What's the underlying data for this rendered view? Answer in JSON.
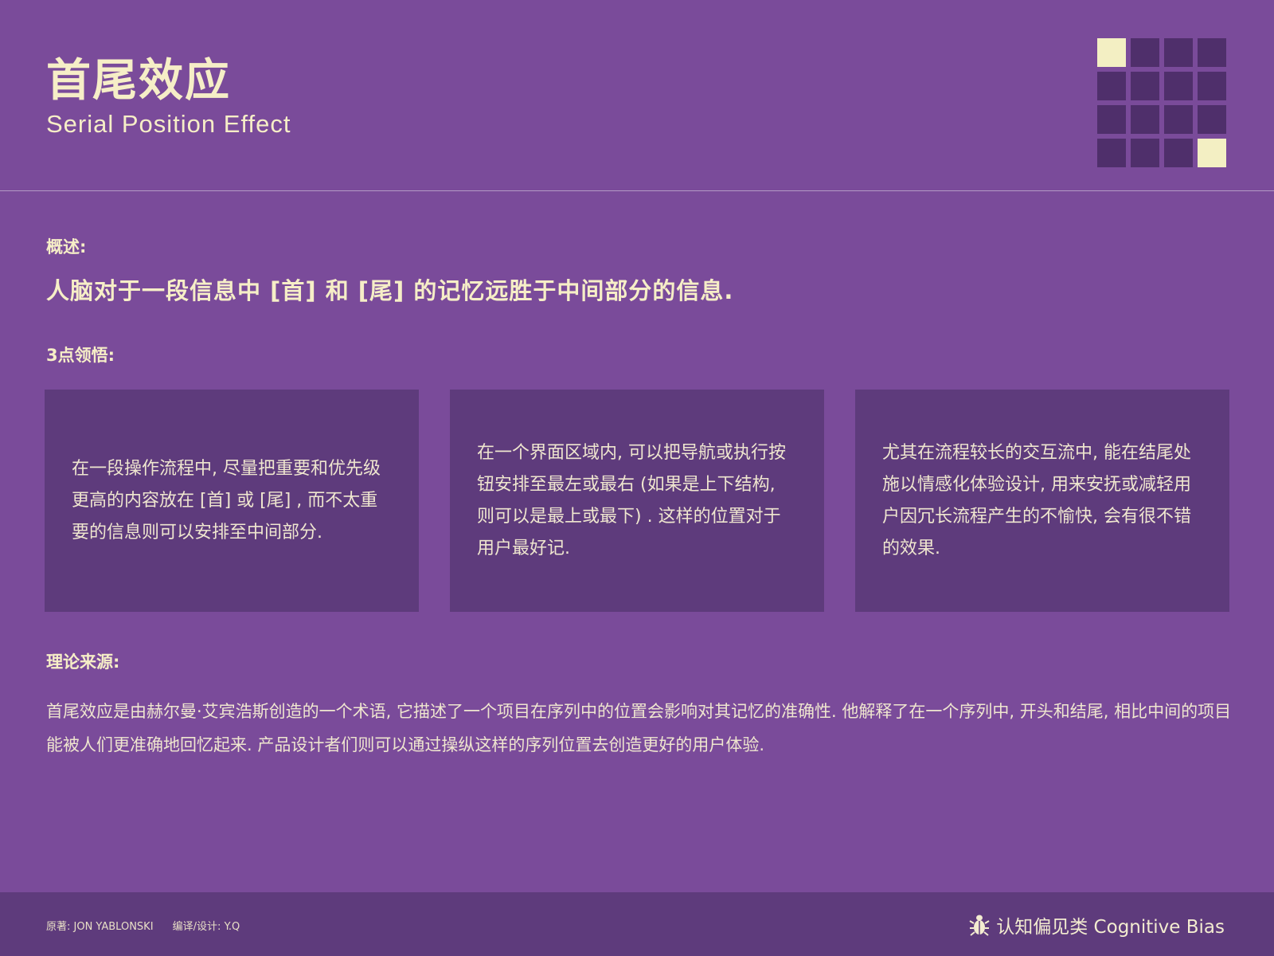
{
  "header": {
    "title_cn": "首尾效应",
    "title_en": "Serial Position Effect",
    "grid_highlight": [
      0,
      15
    ],
    "grid_colors": {
      "off": "#4f2f6b",
      "on": "#f3efc3"
    }
  },
  "overview": {
    "label": "概述:",
    "summary": "人脑对于一段信息中 [首] 和 [尾] 的记忆远胜于中间部分的信息."
  },
  "insights": {
    "label": "3点领悟:",
    "cards": [
      {
        "text": "在一段操作流程中, 尽量把重要和优先级更高的内容放在 [首] 或 [尾] , 而不太重要的信息则可以安排至中间部分."
      },
      {
        "text": "在一个界面区域内, 可以把导航或执行按钮安排至最左或最右 (如果是上下结构, 则可以是最上或最下) . 这样的位置对于用户最好记."
      },
      {
        "text": "尤其在流程较长的交互流中, 能在结尾处施以情感化体验设计, 用来安抚或减轻用户因冗长流程产生的不愉快, 会有很不错的效果."
      }
    ]
  },
  "theory": {
    "label": "理论来源:",
    "text": "首尾效应是由赫尔曼·艾宾浩斯创造的一个术语, 它描述了一个项目在序列中的位置会影响对其记忆的准确性. 他解释了在一个序列中, 开头和结尾, 相比中间的项目能被人们更准确地回忆起来. 产品设计者们则可以通过操纵这样的序列位置去创造更好的用户体验."
  },
  "footer": {
    "author": "原著: JON YABLONSKI",
    "translator": "编译/设计: Y.Q",
    "brand_text": "认知偏见类 Cognitive Bias",
    "brand_icon": "bug-icon"
  },
  "colors": {
    "background": "#7a4b9a",
    "panel": "#5e3b7c",
    "accent": "#f3efc3"
  }
}
